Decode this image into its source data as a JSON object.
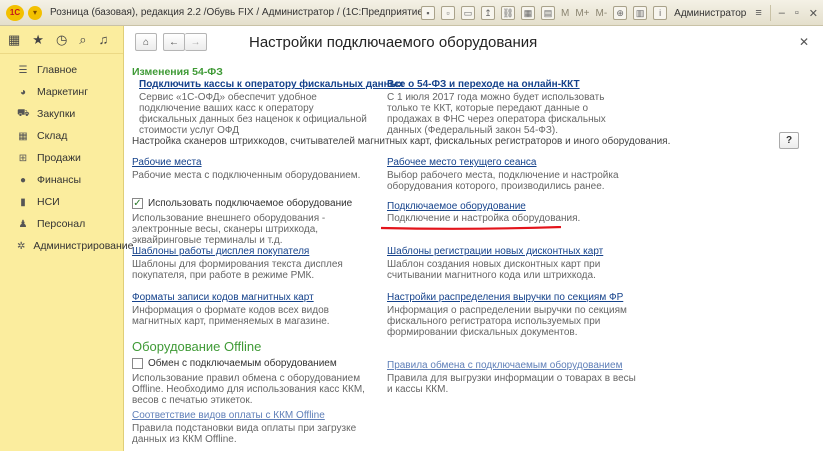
{
  "window": {
    "title": "Розница (базовая), редакция 2.2 /Обувь FIX / Администратор / (1С:Предприятие)",
    "logo": "1С",
    "toolbar_m": "M",
    "toolbar_mplus": "M+",
    "toolbar_mminus": "M-",
    "user": "Администратор"
  },
  "sidebar": {
    "items": [
      {
        "label": "Главное",
        "icon": "list-icon"
      },
      {
        "label": "Маркетинг",
        "icon": "pie-chart-icon"
      },
      {
        "label": "Закупки",
        "icon": "cart-icon"
      },
      {
        "label": "Склад",
        "icon": "warehouse-icon"
      },
      {
        "label": "Продажи",
        "icon": "basket-icon"
      },
      {
        "label": "Финансы",
        "icon": "coin-icon"
      },
      {
        "label": "НСИ",
        "icon": "books-icon"
      },
      {
        "label": "Персонал",
        "icon": "person-icon"
      },
      {
        "label": "Администрирование",
        "icon": "gear-icon"
      }
    ]
  },
  "page": {
    "title": "Настройки подключаемого оборудования",
    "help_label": "?",
    "changes_header": "Изменения 54-ФЗ",
    "link_kassy": "Подключить кассы к оператору фискальных данных",
    "desc_kassy": "Сервис «1С-ОФД» обеспечит удобное подключение ваших касс к оператору фискальных данных без наценок к официальной стоимости услуг ОФД",
    "link_54fz": "Все о 54-ФЗ и переходе на онлайн-ККТ",
    "desc_54fz": "С 1 июля 2017 года можно будет использовать только те ККТ, которые передают данные о продажах в ФНС через оператора фискальных данных (Федеральный закон 54-ФЗ).",
    "intro": "Настройка сканеров штрихкодов, считывателей магнитных карт, фискальных регистраторов и иного оборудования.",
    "link_workplaces": "Рабочие места",
    "desc_workplaces": "Рабочие места с подключенным оборудованием.",
    "link_current_wp": "Рабочее место текущего сеанса",
    "desc_current_wp": "Выбор рабочего места, подключение и настройка оборудования которого, производились ранее.",
    "check_use_equipment": "Использовать подключаемое оборудование",
    "desc_use_equipment": "Использование внешнего оборудования - электронные весы, сканеры штрихкода, эквайринговые терминалы и т.д.",
    "link_equipment": "Подключаемое оборудование",
    "desc_equipment": "Подключение и настройка оборудования.",
    "link_display_templates": "Шаблоны работы дисплея покупателя",
    "desc_display_templates": "Шаблоны для формирования текста дисплея покупателя, при работе в режиме РМК.",
    "link_card_templates": "Шаблоны регистрации новых дисконтных карт",
    "desc_card_templates": "Шаблон создания новых дисконтных карт при считывании магнитного кода или штрихкода.",
    "link_mag_formats": "Форматы записи кодов магнитных карт",
    "desc_mag_formats": "Информация о формате кодов всех видов магнитных карт, применяемых в магазине.",
    "link_revenue": "Настройки распределения выручки по секциям ФР",
    "desc_revenue": "Информация о распределении выручки по секциям фискального регистратора используемых при формировании фискальных документов.",
    "offline_header": "Оборудование Offline",
    "check_offline": "Обмен с подключаемым оборудованием",
    "desc_offline": "Использование правил обмена с оборудованием Offline. Необходимо для использования касс ККМ, весов с печатью этикеток.",
    "link_exchange_rules": "Правила обмена с подключаемым оборудованием",
    "desc_exchange_rules": "Правила для выгрузки информации о товарах в весы и кассы ККМ.",
    "link_payment_match": "Соответствие видов оплаты с ККМ Offline",
    "desc_payment_match": "Правила подстановки вида оплаты при загрузке данных из ККМ Offline."
  },
  "colors": {
    "sidebar_bg": "#fbed9e",
    "link": "#15428b",
    "section_green": "#3f9a36",
    "annotation_red": "#e3141b"
  }
}
